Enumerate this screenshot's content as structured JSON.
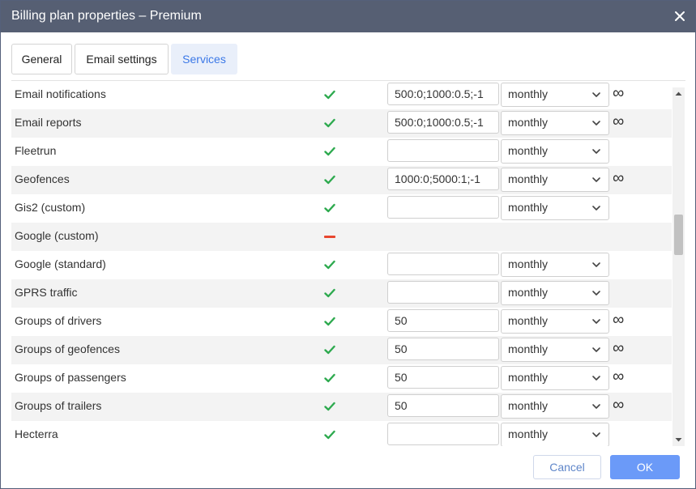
{
  "window": {
    "title": "Billing plan properties – Premium"
  },
  "tabs": [
    {
      "label": "General",
      "active": false
    },
    {
      "label": "Email settings",
      "active": false
    },
    {
      "label": "Services",
      "active": true
    }
  ],
  "colors": {
    "titlebar": "#565f73",
    "accent": "#3b78e7",
    "check": "#2eaa4f",
    "dash": "#e8472f",
    "ok_button": "#6b9af8"
  },
  "services": [
    {
      "name": "Email notifications",
      "enabled": true,
      "value": "500:0;1000:0.5;-1",
      "period": "monthly",
      "infinity": true
    },
    {
      "name": "Email reports",
      "enabled": true,
      "value": "500:0;1000:0.5;-1",
      "period": "monthly",
      "infinity": true
    },
    {
      "name": "Fleetrun",
      "enabled": true,
      "value": "",
      "period": "monthly",
      "infinity": false
    },
    {
      "name": "Geofences",
      "enabled": true,
      "value": "1000:0;5000:1;-1",
      "period": "monthly",
      "infinity": true
    },
    {
      "name": "Gis2 (custom)",
      "enabled": true,
      "value": "",
      "period": "monthly",
      "infinity": false
    },
    {
      "name": "Google (custom)",
      "enabled": false,
      "value": null,
      "period": null,
      "infinity": false
    },
    {
      "name": "Google (standard)",
      "enabled": true,
      "value": "",
      "period": "monthly",
      "infinity": false
    },
    {
      "name": "GPRS traffic",
      "enabled": true,
      "value": "",
      "period": "monthly",
      "infinity": false
    },
    {
      "name": "Groups of drivers",
      "enabled": true,
      "value": "50",
      "period": "monthly",
      "infinity": true
    },
    {
      "name": "Groups of geofences",
      "enabled": true,
      "value": "50",
      "period": "monthly",
      "infinity": true
    },
    {
      "name": "Groups of passengers",
      "enabled": true,
      "value": "50",
      "period": "monthly",
      "infinity": true
    },
    {
      "name": "Groups of trailers",
      "enabled": true,
      "value": "50",
      "period": "monthly",
      "infinity": true
    },
    {
      "name": "Hecterra",
      "enabled": true,
      "value": "",
      "period": "monthly",
      "infinity": false
    }
  ],
  "icons": {
    "enabled": "check-icon",
    "disabled": "dash-icon",
    "dropdown": "chevron-down-icon",
    "unlimited": "infinity-icon",
    "close": "close-icon"
  },
  "infinity_symbol": "∞",
  "footer": {
    "cancel_label": "Cancel",
    "ok_label": "OK"
  }
}
